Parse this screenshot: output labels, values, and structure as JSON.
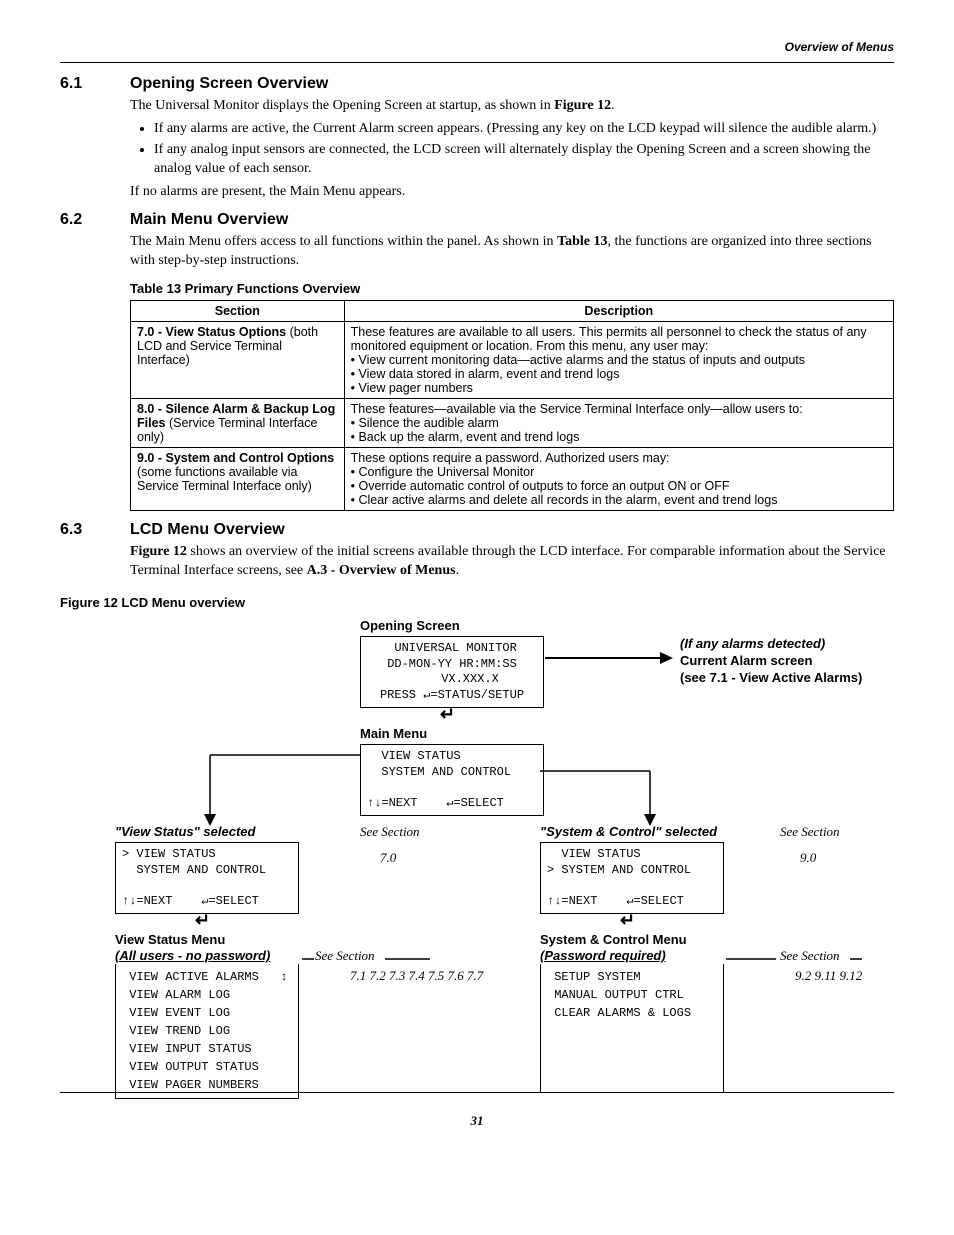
{
  "header": {
    "title": "Overview of Menus"
  },
  "s61": {
    "num": "6.1",
    "title": "Opening Screen Overview",
    "p1_a": "The Universal Monitor displays the Opening Screen at startup, as shown in ",
    "p1_b": "Figure 12",
    "p1_c": ".",
    "b1": "If any alarms are active, the Current Alarm screen appears. (Pressing any key on the LCD keypad will silence the audible alarm.)",
    "b2": "If any analog input sensors are connected, the LCD screen will alternately display the Opening Screen and a screen showing the analog value of each sensor.",
    "p2": "If no alarms are present, the Main Menu appears."
  },
  "s62": {
    "num": "6.2",
    "title": "Main Menu Overview",
    "p1_a": "The Main Menu offers access to all functions within the panel. As shown in ",
    "p1_b": "Table 13",
    "p1_c": ", the functions are organized into three sections with step-by-step instructions.",
    "table_caption": "Table 13    Primary Functions Overview",
    "th1": "Section",
    "th2": "Description",
    "r1c1": "7.0 - View Status Options (both LCD and Service Terminal Interface)",
    "r1c2": "These features are available to all users. This permits all personnel to check the status of any monitored equipment or location. From this menu, any user may:\n• View current monitoring data—active alarms and the status of inputs and outputs\n• View data stored in alarm, event and trend logs\n• View pager numbers",
    "r2c1": "8.0 - Silence Alarm & Backup Log Files (Service Terminal Interface only)",
    "r2c2": "These features—available via the Service Terminal Interface only—allow users to:\n• Silence the audible alarm\n• Back up the alarm, event and trend logs",
    "r3c1": "9.0 - System and Control Options (some functions available via Service Terminal Interface only)",
    "r3c2": "These options require a password. Authorized users may:\n• Configure the Universal Monitor\n• Override automatic control of outputs to force an output ON or OFF\n• Clear active alarms and delete all records in the alarm, event and trend logs"
  },
  "s63": {
    "num": "6.3",
    "title": "LCD Menu Overview",
    "p1_a": "Figure 12",
    "p1_b": " shows an overview of the initial screens available through the LCD interface. For comparable information about the Service Terminal Interface screens, see ",
    "p1_c": "A.3 - Overview of Menus",
    "p1_d": ".",
    "fig_caption": "Figure 12  LCD Menu overview"
  },
  "diagram": {
    "opening_label": "Opening Screen",
    "opening_lcd": " UNIVERSAL MONITOR\nDD-MON-YY HR:MM:SS\n     VX.XXX.X\nPRESS ↵=STATUS/SETUP",
    "alarm_note1": "(If any alarms detected)",
    "alarm_note2": "Current Alarm screen",
    "alarm_note3": "(see 7.1 - View Active Alarms)",
    "main_label": "Main Menu",
    "main_lcd": "  VIEW STATUS\n  SYSTEM AND CONTROL\n\n↑↓=NEXT    ↵=SELECT",
    "vs_sel_label": "\"View Status\" selected",
    "sc_sel_label": "\"System & Control\" selected",
    "see_section": "See Section",
    "vs_lcd": "> VIEW STATUS\n  SYSTEM AND CONTROL\n\n↑↓=NEXT    ↵=SELECT",
    "sc_lcd": "  VIEW STATUS\n> SYSTEM AND CONTROL\n\n↑↓=NEXT    ↵=SELECT",
    "vs_sec": "7.0",
    "sc_sec": "9.0",
    "vs_menu_label": "View Status Menu",
    "vs_menu_sub": "(All users - no password)",
    "sc_menu_label": "System & Control Menu",
    "sc_menu_sub": "(Password required)",
    "vs_items": " VIEW ACTIVE ALARMS   ↕\n VIEW ALARM LOG\n VIEW EVENT LOG\n VIEW TREND LOG\n VIEW INPUT STATUS\n VIEW OUTPUT STATUS\n VIEW PAGER NUMBERS",
    "vs_secs": "7.1\n7.2\n7.3\n7.4\n7.5\n7.6\n7.7",
    "sc_items": " SETUP SYSTEM\n MANUAL OUTPUT CTRL\n CLEAR ALARMS & LOGS",
    "sc_secs": "9.2\n9.11\n9.12"
  },
  "page": "31"
}
